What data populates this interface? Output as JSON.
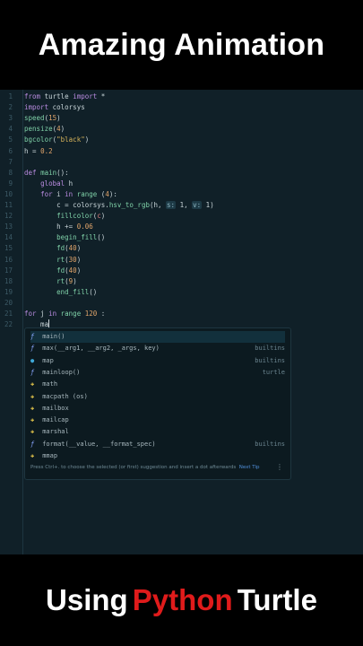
{
  "banner": {
    "top_title": "Amazing Animation",
    "bottom_part1": "Using ",
    "bottom_part2": "Python",
    "bottom_part3": " Turtle"
  },
  "colors": {
    "python_red": "#e01b1b",
    "editor_bg": "#102028"
  },
  "code": {
    "line_numbers": [
      "1",
      "2",
      "3",
      "4",
      "5",
      "6",
      "7",
      "8",
      "9",
      "10",
      "11",
      "12",
      "13",
      "14",
      "15",
      "16",
      "17",
      "18",
      "19",
      "20",
      "21",
      "22"
    ],
    "l1": [
      "from",
      " turtle ",
      "import",
      " *"
    ],
    "l2": [
      "import",
      " colorsys"
    ],
    "l3": [
      "speed",
      "(",
      "15",
      ")"
    ],
    "l4": [
      "pensize",
      "(",
      "4",
      ")"
    ],
    "l5": [
      "bgcolor",
      "(",
      "\"black\"",
      ")"
    ],
    "l6": [
      "h",
      " = ",
      "0.2"
    ],
    "l8": [
      "def",
      " ",
      "main",
      "():"
    ],
    "l9": [
      "    ",
      "global",
      " h"
    ],
    "l10": [
      "    ",
      "for",
      " i ",
      "in",
      " ",
      "range",
      " (",
      "4",
      "):"
    ],
    "l11": [
      "        c = colorsys.",
      "hsv_to_rgb",
      "(h, ",
      "s:",
      " 1, ",
      "v:",
      " 1)"
    ],
    "l12": [
      "        ",
      "fillcolor",
      "(",
      "c",
      ")"
    ],
    "l13": [
      "        h += ",
      "0.06"
    ],
    "l14": [
      "        ",
      "begin_fill",
      "()"
    ],
    "l15": [
      "        ",
      "fd",
      "(",
      "40",
      ")"
    ],
    "l16": [
      "        ",
      "rt",
      "(",
      "30",
      ")"
    ],
    "l17": [
      "        ",
      "fd",
      "(",
      "40",
      ")"
    ],
    "l18": [
      "        ",
      "rt",
      "(",
      "9",
      ")"
    ],
    "l19": [
      "        ",
      "end_fill",
      "()"
    ],
    "l21": [
      "for",
      " j ",
      "in",
      " ",
      "range",
      " ",
      "120",
      " :"
    ],
    "l22": [
      "    ma"
    ]
  },
  "completion": {
    "items": [
      {
        "icon": "f",
        "label": "main()",
        "source": ""
      },
      {
        "icon": "f",
        "label": "max(__arg1, __arg2, _args, key)",
        "source": "builtins"
      },
      {
        "icon": "m",
        "label": "map",
        "source": "builtins"
      },
      {
        "icon": "f",
        "label": "mainloop()",
        "source": "turtle"
      },
      {
        "icon": "p",
        "label": "math",
        "source": ""
      },
      {
        "icon": "p",
        "label": "macpath (os)",
        "source": ""
      },
      {
        "icon": "p",
        "label": "mailbox",
        "source": ""
      },
      {
        "icon": "p",
        "label": "mailcap",
        "source": ""
      },
      {
        "icon": "p",
        "label": "marshal",
        "source": ""
      },
      {
        "icon": "f",
        "label": "format(__value, __format_spec)",
        "source": "builtins"
      },
      {
        "icon": "p",
        "label": "mmap",
        "source": ""
      }
    ],
    "tip_text": "Press Ctrl+. to choose the selected (or first) suggestion and insert a dot afterwards",
    "next_tip": "Next Tip",
    "menu_glyph": "⋮"
  }
}
